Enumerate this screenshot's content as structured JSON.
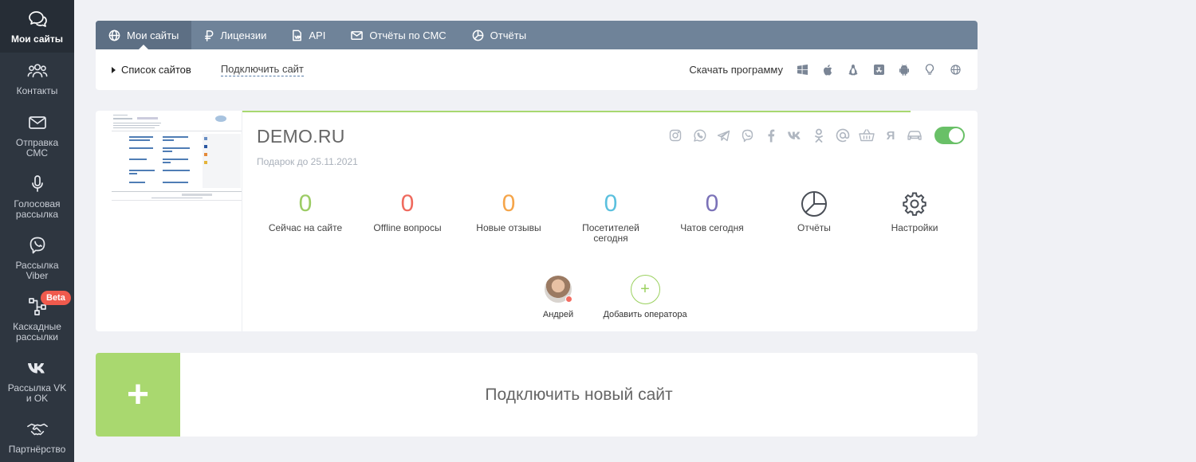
{
  "sidebar": {
    "items": [
      {
        "label": "Мои сайты",
        "icon": "chat-bubbles-icon"
      },
      {
        "label": "Контакты",
        "icon": "users-icon"
      },
      {
        "label": "Отправка СМС",
        "icon": "envelope-icon"
      },
      {
        "label": "Голосовая рассылка",
        "icon": "microphone-icon"
      },
      {
        "label": "Рассылка Viber",
        "icon": "viber-icon"
      },
      {
        "label": "Каскадные рассылки",
        "icon": "cascade-icon",
        "badge": "Beta"
      },
      {
        "label": "Рассылка VK и OK",
        "icon": "vk-icon"
      },
      {
        "label": "Партнёрство",
        "icon": "handshake-icon"
      }
    ]
  },
  "tabs": [
    {
      "label": "Мои сайты",
      "icon": "globe-icon"
    },
    {
      "label": "Лицензии",
      "icon": "ruble-icon"
    },
    {
      "label": "API",
      "icon": "api-doc-icon"
    },
    {
      "label": "Отчёты по СМС",
      "icon": "envelope-icon"
    },
    {
      "label": "Отчёты",
      "icon": "pie-chart-icon"
    }
  ],
  "subbar": {
    "list_label": "Список сайтов",
    "connect_label": "Подключить сайт",
    "download_label": "Скачать программу",
    "platforms": [
      "windows-icon",
      "apple-icon",
      "linux-icon",
      "app-store-icon",
      "android-icon",
      "lightbulb-icon",
      "globe-icon"
    ]
  },
  "site": {
    "title": "DEMO.RU",
    "gift": "Подарок до 25.11.2021",
    "channels": [
      "instagram-icon",
      "whatsapp-icon",
      "telegram-icon",
      "viber-icon",
      "facebook-icon",
      "vk-icon",
      "odnoklassniki-icon",
      "email-icon",
      "basket-icon",
      "yandex-icon",
      "car-icon"
    ],
    "yandex_glyph": "Я",
    "enabled": true,
    "stats": [
      {
        "value": "0",
        "label": "Сейчас на сайте",
        "color": "#9ccc65"
      },
      {
        "value": "0",
        "label": "Offline вопросы",
        "color": "#ef6a5e"
      },
      {
        "value": "0",
        "label": "Новые отзывы",
        "color": "#f5a54a"
      },
      {
        "value": "0",
        "label": "Посетителей сегодня",
        "color": "#5bc0de"
      },
      {
        "value": "0",
        "label": "Чатов сегодня",
        "color": "#7b72b8"
      }
    ],
    "actions": [
      {
        "label": "Отчёты",
        "icon": "pie-chart-icon"
      },
      {
        "label": "Настройки",
        "icon": "gear-icon"
      }
    ],
    "operators": [
      {
        "name": "Андрей",
        "status": "offline"
      }
    ],
    "add_operator_label": "Добавить оператора"
  },
  "new_site": {
    "label": "Подключить новый сайт"
  },
  "colors": {
    "sidebar_bg": "#2e3640",
    "tabbar_bg": "#6f8399",
    "accent_green": "#a9d86f",
    "toggle_on": "#69c067"
  }
}
